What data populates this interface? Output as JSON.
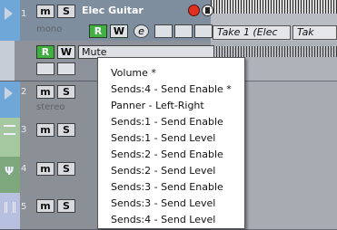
{
  "colors": {
    "record": "#e03020",
    "rec_enable": "#40b040",
    "track_blue": "#6fa8d8",
    "track_green": "#a6c8a0",
    "track_violet": "#b8c0e0"
  },
  "tracks": [
    {
      "num": "1",
      "m": "m",
      "s": "S",
      "name": "Elec Guitar",
      "sub": "mono",
      "r": "R",
      "w": "W"
    },
    {
      "num": "2",
      "m": "m",
      "s": "S",
      "sub": "stereo"
    },
    {
      "num": "3",
      "m": "m",
      "s": "S"
    },
    {
      "num": "4",
      "m": "m",
      "s": "S"
    },
    {
      "num": "5",
      "m": "m",
      "s": "S"
    }
  ],
  "automation": {
    "r": "R",
    "w": "W",
    "param": "Mute"
  },
  "events": {
    "take1": "Take 1 (Elec",
    "take2": "Tak"
  },
  "menu": {
    "items": [
      "Volume *",
      "Sends:4 - Send Enable *",
      "Panner - Left-Right",
      "Sends:1 - Send Enable",
      "Sends:1 - Send Level",
      "Sends:2 - Send Enable",
      "Sends:2 - Send Level",
      "Sends:3 - Send Enable",
      "Sends:3 - Send Level",
      "Sends:4 - Send Level"
    ]
  }
}
